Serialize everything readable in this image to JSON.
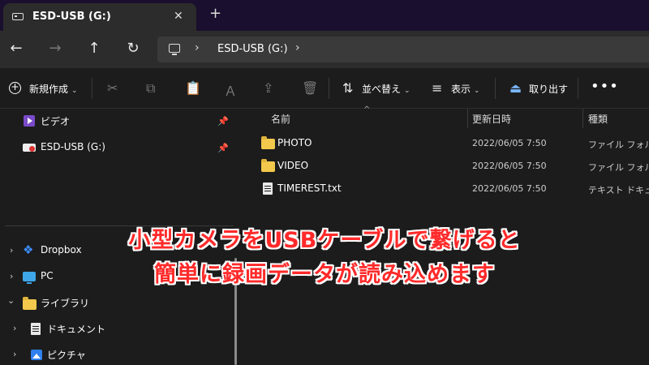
{
  "tab": {
    "title": "ESD-USB (G:)",
    "close": "✕",
    "new": "+"
  },
  "address": {
    "crumb": "ESD-USB (G:)",
    "chevron": "›"
  },
  "nav": {
    "back": "←",
    "forward": "→",
    "up": "↑",
    "refresh": "↻"
  },
  "toolbar": {
    "new_label": "新規作成",
    "sort_label": "並べ替え",
    "view_label": "表示",
    "eject_label": "取り出す",
    "more": "•••"
  },
  "sidebar": {
    "quick": [
      {
        "label": "ビデオ",
        "icon": "video-icon"
      },
      {
        "label": "ESD-USB (G:)",
        "icon": "usb-drive-icon"
      }
    ],
    "tree": [
      {
        "label": "Dropbox",
        "icon": "dropbox-icon"
      },
      {
        "label": "PC",
        "icon": "pc-icon"
      },
      {
        "label": "ライブラリ",
        "icon": "folder-icon"
      },
      {
        "label": "ドキュメント",
        "icon": "document-icon"
      },
      {
        "label": "ピクチャ",
        "icon": "picture-icon"
      }
    ]
  },
  "columns": {
    "name": "名前",
    "date": "更新日時",
    "type": "種類"
  },
  "files": [
    {
      "name": "PHOTO",
      "date": "2022/06/05 7:50",
      "type": "ファイル フォルダー",
      "icon": "folder-icon"
    },
    {
      "name": "VIDEO",
      "date": "2022/06/05 7:50",
      "type": "ファイル フォルダー",
      "icon": "folder-icon"
    },
    {
      "name": "TIMEREST.txt",
      "date": "2022/06/05 7:50",
      "type": "テキスト ドキュメント",
      "icon": "text-file-icon"
    }
  ],
  "caption": {
    "line1": "小型カメラをUSBケーブルで繋げると",
    "line2": "簡単に録画データが読み込めます"
  },
  "colors": {
    "caption": "#ff2a2a",
    "folder": "#f2c94c",
    "titlebar": "#1a0f2e"
  }
}
